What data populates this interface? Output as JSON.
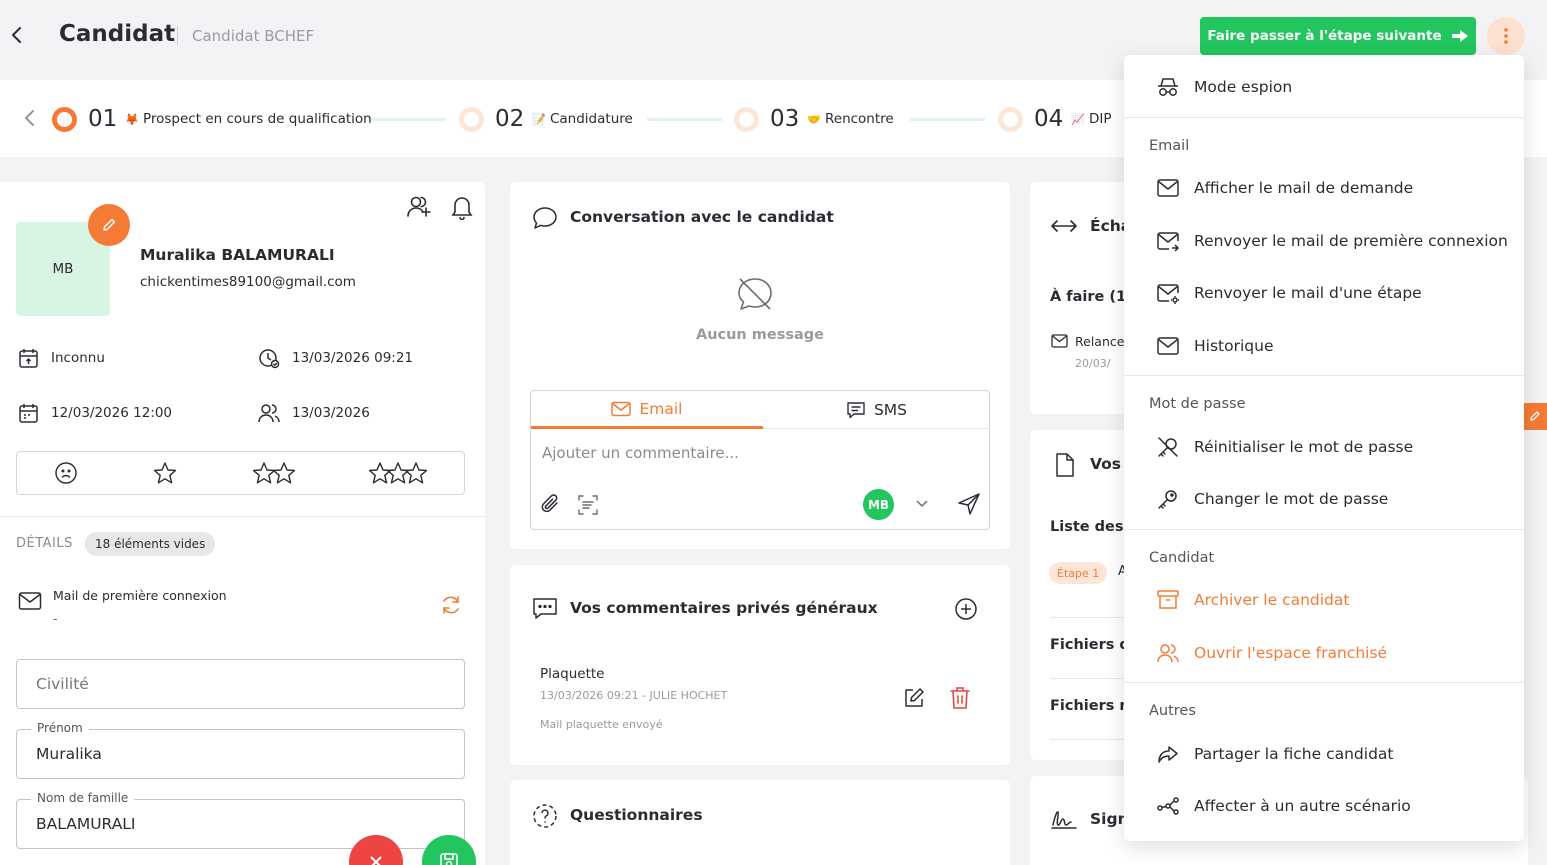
{
  "header": {
    "title": "Candidat",
    "subtitle": "Candidat BCHEF",
    "next_step_label": "Faire passer à l'étape suivante"
  },
  "stepper": {
    "steps": [
      {
        "num": "01",
        "emoji": "🦊",
        "label": "Prospect en cours de qualification",
        "active": true
      },
      {
        "num": "02",
        "emoji": "📝",
        "label": "Candidature",
        "active": false
      },
      {
        "num": "03",
        "emoji": "🤝",
        "label": "Rencontre",
        "active": false
      },
      {
        "num": "04",
        "emoji": "📈",
        "label": "DIP",
        "active": false
      }
    ]
  },
  "profile": {
    "initials": "MB",
    "name": "Muralika BALAMURALI",
    "email": "chickentimes89100@gmail.com",
    "origin": "Inconnu",
    "created_at": "13/03/2026 09:21",
    "date": "12/03/2026 12:00",
    "contact_date": "13/03/2026",
    "details_label": "DÉTAILS",
    "empty_badge": "18 éléments vides",
    "first_login_mail": {
      "title": "Mail de première connexion",
      "value": "-"
    },
    "fields": {
      "civilite_placeholder": "Civilité",
      "prenom_label": "Prénom",
      "prenom_value": "Muralika",
      "nom_label": "Nom de famille",
      "nom_value": "BALAMURALI"
    }
  },
  "conversation": {
    "title": "Conversation avec le candidat",
    "empty": "Aucun message",
    "tab_email": "Email",
    "tab_sms": "SMS",
    "placeholder": "Ajouter un commentaire...",
    "sender_initials": "MB"
  },
  "comments": {
    "title": "Vos commentaires privés généraux",
    "item": {
      "title": "Plaquette",
      "meta": "13/03/2026 09:21 - JULIE HOCHET",
      "body": "Mail plaquette envoyé"
    }
  },
  "questionnaires": {
    "title": "Questionnaires"
  },
  "right_column": {
    "echanges_title": "Écha",
    "todo_label": "À faire (1)",
    "todo_item": "Relance",
    "todo_date": "20/03/",
    "docs_title": "Vos",
    "docs_list": "Liste des",
    "stage_badge": "Étape 1",
    "stage_badge_after": "A",
    "files_1": "Fichiers d",
    "files_2": "Fichiers n",
    "sign_title": "Sign"
  },
  "menu": {
    "spy": "Mode espion",
    "email_header": "Email",
    "email_items": [
      "Afficher le mail de demande",
      "Renvoyer le mail de première connexion",
      "Renvoyer le mail d'une étape",
      "Historique"
    ],
    "password_header": "Mot de passe",
    "password_items": [
      "Réinitialiser le mot de passe",
      "Changer le mot de passe"
    ],
    "candidate_header": "Candidat",
    "candidate_items": [
      "Archiver le candidat",
      "Ouvrir l'espace franchisé"
    ],
    "other_header": "Autres",
    "other_items": [
      "Partager la fiche candidat",
      "Affecter à un autre scénario"
    ]
  },
  "colors": {
    "accent": "#f47b36",
    "success": "#22c55e",
    "danger": "#ef4444"
  }
}
